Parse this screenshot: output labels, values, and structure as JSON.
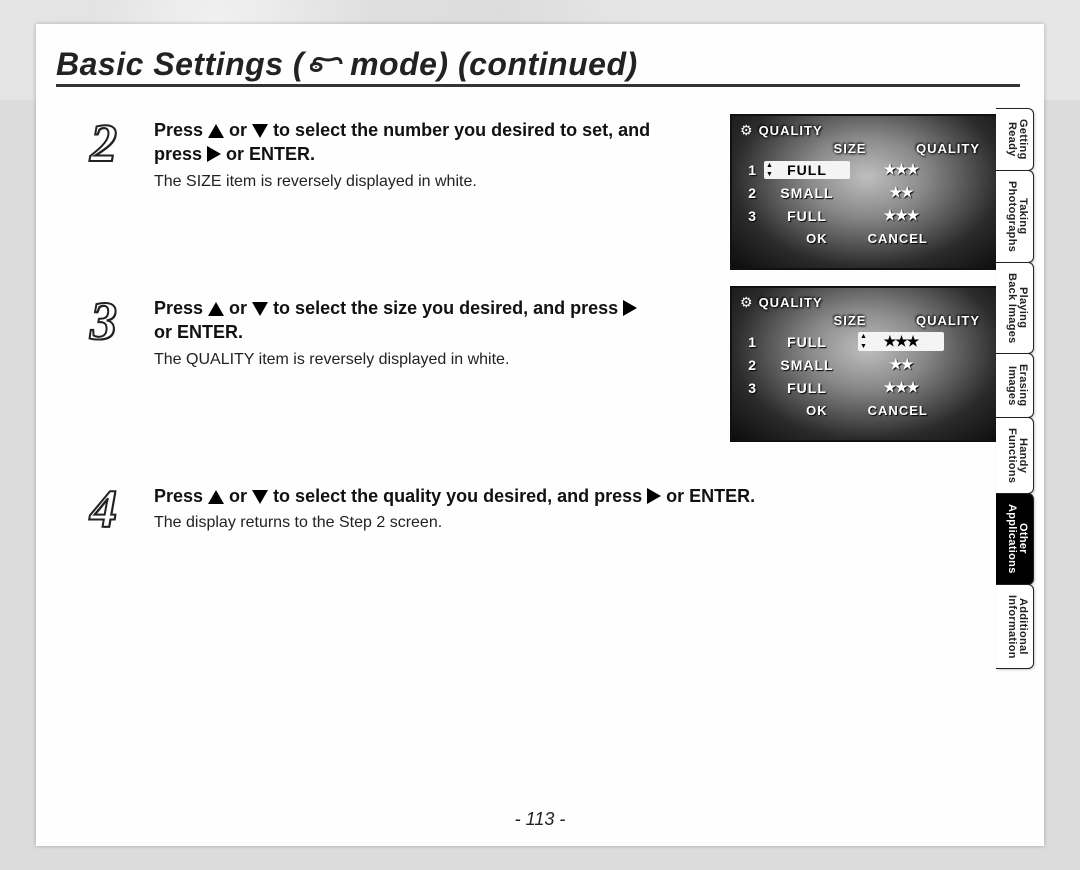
{
  "title": {
    "prefix": "Basic Settings (",
    "suffix": " mode) (continued)"
  },
  "steps": [
    {
      "num": "2",
      "bold_parts": {
        "a": "Press ",
        "b": " or ",
        "c": " to select the number you desired to set, and press ",
        "d": " or ENTER."
      },
      "note": "The SIZE item is reversely displayed in white."
    },
    {
      "num": "3",
      "bold_parts": {
        "a": "Press ",
        "b": " or ",
        "c": " to select the size you desired, and press ",
        "d": " or ENTER."
      },
      "note": "The QUALITY item is reversely displayed in white."
    },
    {
      "num": "4",
      "bold_parts": {
        "a": "Press ",
        "b": " or ",
        "c": " to select  the quality you desired, and press ",
        "d": " or ENTER."
      },
      "note": "The display returns to the Step 2 screen."
    }
  ],
  "lcd": {
    "menu_title": "QUALITY",
    "headers": {
      "size": "SIZE",
      "quality": "QUALITY"
    },
    "rows": [
      {
        "n": "1",
        "size": "FULL",
        "quality": "★★★"
      },
      {
        "n": "2",
        "size": "SMALL",
        "quality": "★★"
      },
      {
        "n": "3",
        "size": "FULL",
        "quality": "★★★"
      }
    ],
    "ok": "OK",
    "cancel": "CANCEL",
    "screen1": {
      "selected_row": 0,
      "selected_col": "size"
    },
    "screen2": {
      "selected_row": 0,
      "selected_col": "quality"
    }
  },
  "tabs": [
    {
      "l1": "Getting",
      "l2": "Ready"
    },
    {
      "l1": "Taking",
      "l2": "Photographs"
    },
    {
      "l1": "Playing",
      "l2": "Back Images"
    },
    {
      "l1": "Erasing",
      "l2": "Images"
    },
    {
      "l1": "Handy",
      "l2": "Functions"
    },
    {
      "l1": "Other",
      "l2": "Applications",
      "active": true
    },
    {
      "l1": "Additional",
      "l2": "Information"
    }
  ],
  "page_number": "- 113 -"
}
